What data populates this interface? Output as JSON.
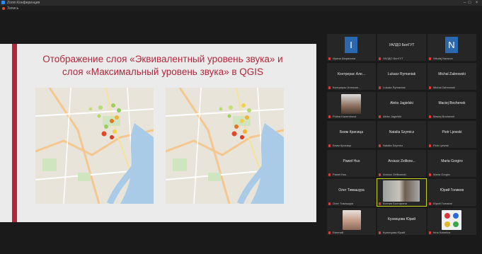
{
  "window": {
    "title": "Zoom Конференция",
    "rec_label": "Запись"
  },
  "slide": {
    "title": "Отображение слоя «Эквивалентный уровень звука» и\nслоя «Максимальный уровень звука» в QGIS"
  },
  "participants": [
    {
      "name": "",
      "label": "Ирина Ширинина",
      "avatar": "I",
      "avatar_color": "#2a68b0"
    },
    {
      "name": "УАЛДО БелГУТ",
      "label": "УАЛДО БелГУТ",
      "avatar": "",
      "avatar_color": ""
    },
    {
      "name": "",
      "label": "Nikolaj Nazarov",
      "avatar": "N",
      "avatar_color": "#2a68b0"
    },
    {
      "name": "Контрерас Але...",
      "label": "Контрерас Алексан...",
      "avatar": "",
      "avatar_color": ""
    },
    {
      "name": "Lukasz Rymaniak",
      "label": "Lukasz Rymaniak",
      "avatar": "",
      "avatar_color": ""
    },
    {
      "name": "Michal Zabrowski",
      "label": "Michal Zabrowski",
      "avatar": "",
      "avatar_color": ""
    },
    {
      "name": "",
      "label": "Polina Kazemirova",
      "avatar": "",
      "avatar_color": ""
    },
    {
      "name": "Aleks Jagielski",
      "label": "Aleks Jagielski",
      "avatar": "",
      "avatar_color": ""
    },
    {
      "name": "Maciej Bochenek",
      "label": "Maciej Bochenek",
      "avatar": "",
      "avatar_color": ""
    },
    {
      "name": "Беим Крисица",
      "label": "Беим Крисица",
      "avatar": "",
      "avatar_color": ""
    },
    {
      "name": "Natalia Szymicz",
      "label": "Natalia Szymicz",
      "avatar": "",
      "avatar_color": ""
    },
    {
      "name": "Piotr Ljewski",
      "label": "Piotr Ljewski",
      "avatar": "",
      "avatar_color": ""
    },
    {
      "name": "Paweł Hus",
      "label": "Paweł Hus",
      "avatar": "",
      "avatar_color": ""
    },
    {
      "name": "Arsiusz Zelikow...",
      "label": "Arsiusz Zelikowski",
      "avatar": "",
      "avatar_color": ""
    },
    {
      "name": "Maria Gorgiro",
      "label": "Maria Gorgiro",
      "avatar": "",
      "avatar_color": ""
    },
    {
      "name": "Олег Тимашура",
      "label": "Олег Тимашура",
      "avatar": "",
      "avatar_color": ""
    },
    {
      "name": "",
      "label": "Ксения Болгарина",
      "avatar": "",
      "avatar_color": ""
    },
    {
      "name": "Юрий Голиков",
      "label": "Юрий Голиков",
      "avatar": "",
      "avatar_color": ""
    },
    {
      "name": "",
      "label": "Евгений",
      "avatar": "",
      "avatar_color": ""
    },
    {
      "name": "Кузнецова Юрий",
      "label": "Кузнецова Юрий",
      "avatar": "",
      "avatar_color": ""
    },
    {
      "name": "",
      "label": "Irina Kanelica",
      "avatar": "",
      "avatar_color": ""
    }
  ]
}
